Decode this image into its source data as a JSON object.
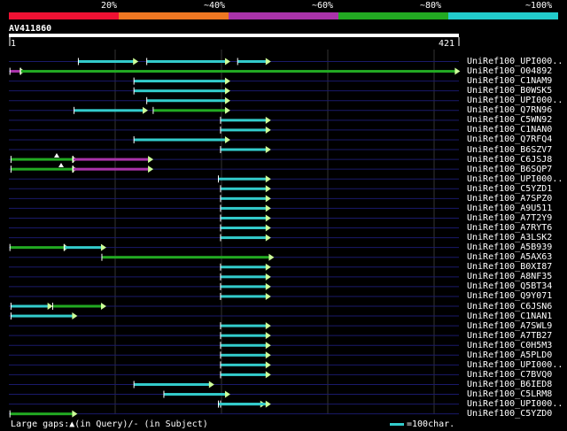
{
  "colors": {
    "background": "#000000",
    "text": "#ffffff",
    "row_line": "#1a1a6a",
    "grid": "#333333",
    "hit_cyan": "#33cccc",
    "hit_green": "#22aa22",
    "hit_purple": "#aa33aa",
    "arrow_head": "#ccff99",
    "legend_bar": [
      "#ee1133",
      "#ee7722",
      "#aa33aa",
      "#22aa22",
      "#22cccc"
    ]
  },
  "legend": {
    "labels": [
      "20%",
      "~40%",
      "~60%",
      "~80%",
      "~100%"
    ]
  },
  "query": {
    "name": "AV411860",
    "start": "1",
    "end": "421",
    "length": 421
  },
  "hits": [
    {
      "name": "UniRef100_UPI000..",
      "segments": [
        {
          "s": 65,
          "e": 117,
          "c": "cyan"
        },
        {
          "s": 129,
          "e": 203,
          "c": "cyan"
        },
        {
          "s": 214,
          "e": 241,
          "c": "cyan"
        }
      ]
    },
    {
      "name": "UniRef100_O04892",
      "segments": [
        {
          "s": 1,
          "e": 11,
          "c": "purple"
        },
        {
          "s": 11,
          "e": 418,
          "c": "green"
        }
      ]
    },
    {
      "name": "UniRef100_C1NAM9",
      "segments": [
        {
          "s": 117,
          "e": 203,
          "c": "cyan"
        }
      ]
    },
    {
      "name": "UniRef100_B0WSK5",
      "segments": [
        {
          "s": 117,
          "e": 203,
          "c": "cyan"
        }
      ]
    },
    {
      "name": "UniRef100_UPI000..",
      "segments": [
        {
          "s": 129,
          "e": 203,
          "c": "cyan"
        }
      ]
    },
    {
      "name": "UniRef100_Q7RN96",
      "segments": [
        {
          "s": 61,
          "e": 126,
          "c": "cyan"
        },
        {
          "s": 135,
          "e": 203,
          "c": "green"
        }
      ]
    },
    {
      "name": "UniRef100_C5WN92",
      "segments": [
        {
          "s": 198,
          "e": 241,
          "c": "cyan"
        }
      ]
    },
    {
      "name": "UniRef100_C1NAN0",
      "segments": [
        {
          "s": 198,
          "e": 241,
          "c": "cyan"
        }
      ]
    },
    {
      "name": "UniRef100_Q7RFQ4",
      "segments": [
        {
          "s": 117,
          "e": 203,
          "c": "cyan"
        }
      ]
    },
    {
      "name": "UniRef100_B6SZV7",
      "segments": [
        {
          "s": 198,
          "e": 241,
          "c": "cyan"
        }
      ]
    },
    {
      "name": "UniRef100_C6JSJ8",
      "segments": [
        {
          "s": 2,
          "e": 60,
          "c": "green"
        },
        {
          "s": 60,
          "e": 131,
          "c": "purple"
        }
      ]
    },
    {
      "name": "UniRef100_B6SQP7",
      "segments": [
        {
          "s": 2,
          "e": 60,
          "c": "green"
        },
        {
          "s": 60,
          "e": 131,
          "c": "purple"
        }
      ]
    },
    {
      "name": "UniRef100_UPI000..",
      "segments": [
        {
          "s": 196,
          "e": 241,
          "c": "cyan"
        }
      ]
    },
    {
      "name": "UniRef100_C5YZD1",
      "segments": [
        {
          "s": 198,
          "e": 241,
          "c": "cyan"
        }
      ]
    },
    {
      "name": "UniRef100_A7SPZ0",
      "segments": [
        {
          "s": 198,
          "e": 241,
          "c": "cyan"
        }
      ]
    },
    {
      "name": "UniRef100_A9U511",
      "segments": [
        {
          "s": 198,
          "e": 241,
          "c": "cyan"
        }
      ]
    },
    {
      "name": "UniRef100_A7T2Y9",
      "segments": [
        {
          "s": 198,
          "e": 241,
          "c": "cyan"
        }
      ]
    },
    {
      "name": "UniRef100_A7RYT6",
      "segments": [
        {
          "s": 198,
          "e": 241,
          "c": "cyan"
        }
      ]
    },
    {
      "name": "UniRef100_A3LSK2",
      "segments": [
        {
          "s": 198,
          "e": 241,
          "c": "cyan"
        }
      ]
    },
    {
      "name": "UniRef100_A5B939",
      "segments": [
        {
          "s": 1,
          "e": 52,
          "c": "green"
        },
        {
          "s": 52,
          "e": 87,
          "c": "cyan"
        }
      ]
    },
    {
      "name": "UniRef100_A5AX63",
      "segments": [
        {
          "s": 87,
          "e": 244,
          "c": "green"
        }
      ]
    },
    {
      "name": "UniRef100_B0XI87",
      "segments": [
        {
          "s": 198,
          "e": 241,
          "c": "cyan"
        }
      ]
    },
    {
      "name": "UniRef100_A8NF35",
      "segments": [
        {
          "s": 198,
          "e": 241,
          "c": "cyan"
        }
      ]
    },
    {
      "name": "UniRef100_Q5BT34",
      "segments": [
        {
          "s": 198,
          "e": 241,
          "c": "cyan"
        }
      ]
    },
    {
      "name": "UniRef100_Q9Y071",
      "segments": [
        {
          "s": 198,
          "e": 241,
          "c": "cyan"
        }
      ]
    },
    {
      "name": "UniRef100_C6JSN6",
      "segments": [
        {
          "s": 2,
          "e": 37,
          "c": "cyan"
        },
        {
          "s": 41,
          "e": 87,
          "c": "green"
        }
      ]
    },
    {
      "name": "UniRef100_C1NAN1",
      "segments": [
        {
          "s": 2,
          "e": 60,
          "c": "cyan"
        }
      ]
    },
    {
      "name": "UniRef100_A7SWL9",
      "segments": [
        {
          "s": 198,
          "e": 241,
          "c": "cyan"
        }
      ]
    },
    {
      "name": "UniRef100_A7TB27",
      "segments": [
        {
          "s": 198,
          "e": 241,
          "c": "cyan"
        }
      ]
    },
    {
      "name": "UniRef100_C0H5M3",
      "segments": [
        {
          "s": 198,
          "e": 241,
          "c": "cyan"
        }
      ]
    },
    {
      "name": "UniRef100_A5PLD0",
      "segments": [
        {
          "s": 198,
          "e": 241,
          "c": "cyan"
        }
      ]
    },
    {
      "name": "UniRef100_UPI000..",
      "segments": [
        {
          "s": 198,
          "e": 241,
          "c": "cyan"
        }
      ]
    },
    {
      "name": "UniRef100_C7BVQ0",
      "segments": [
        {
          "s": 198,
          "e": 241,
          "c": "cyan"
        }
      ]
    },
    {
      "name": "UniRef100_B6IED8",
      "segments": [
        {
          "s": 117,
          "e": 188,
          "c": "cyan"
        }
      ]
    },
    {
      "name": "UniRef100_C5LRM8",
      "segments": [
        {
          "s": 145,
          "e": 203,
          "c": "cyan"
        }
      ]
    },
    {
      "name": "UniRef100_UPI000..",
      "segments": [
        {
          "s": 198,
          "e": 236,
          "c": "cyan"
        },
        {
          "s": 196,
          "e": 241,
          "c": "cyan"
        }
      ]
    },
    {
      "name": "UniRef100_C5YZD0",
      "segments": [
        {
          "s": 1,
          "e": 60,
          "c": "green"
        }
      ]
    }
  ],
  "bottom": {
    "gaps_text": "Large gaps:▲(in Query)/- (in Subject)",
    "scale_text": "=100char."
  }
}
